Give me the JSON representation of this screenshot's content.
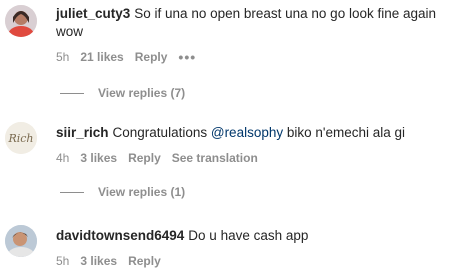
{
  "comments": [
    {
      "username": "juliet_cuty3",
      "text": "So if una no open breast una no go look fine again wow",
      "time": "5h",
      "likes": "21 likes",
      "reply": "Reply",
      "more": "•••",
      "view_replies": "View replies (7)",
      "avatar_icon": "user-avatar-photo"
    },
    {
      "username": "siir_rich",
      "text_before": "Congratulations",
      "mention": "@realsophy",
      "text_after": "biko n'emechi ala gi",
      "time": "4h",
      "likes": "3 likes",
      "reply": "Reply",
      "see_translation": "See translation",
      "view_replies": "View replies (1)",
      "avatar_icon": "rich-logo-avatar",
      "avatar_text": "Rich"
    },
    {
      "username": "davidtownsend6494",
      "text": "Do u have cash app",
      "time": "5h",
      "likes": "3 likes",
      "reply": "Reply",
      "avatar_icon": "user-avatar-photo"
    }
  ],
  "colors": {
    "text": "#262626",
    "secondary": "#8e8e8e",
    "mention": "#00376b"
  }
}
